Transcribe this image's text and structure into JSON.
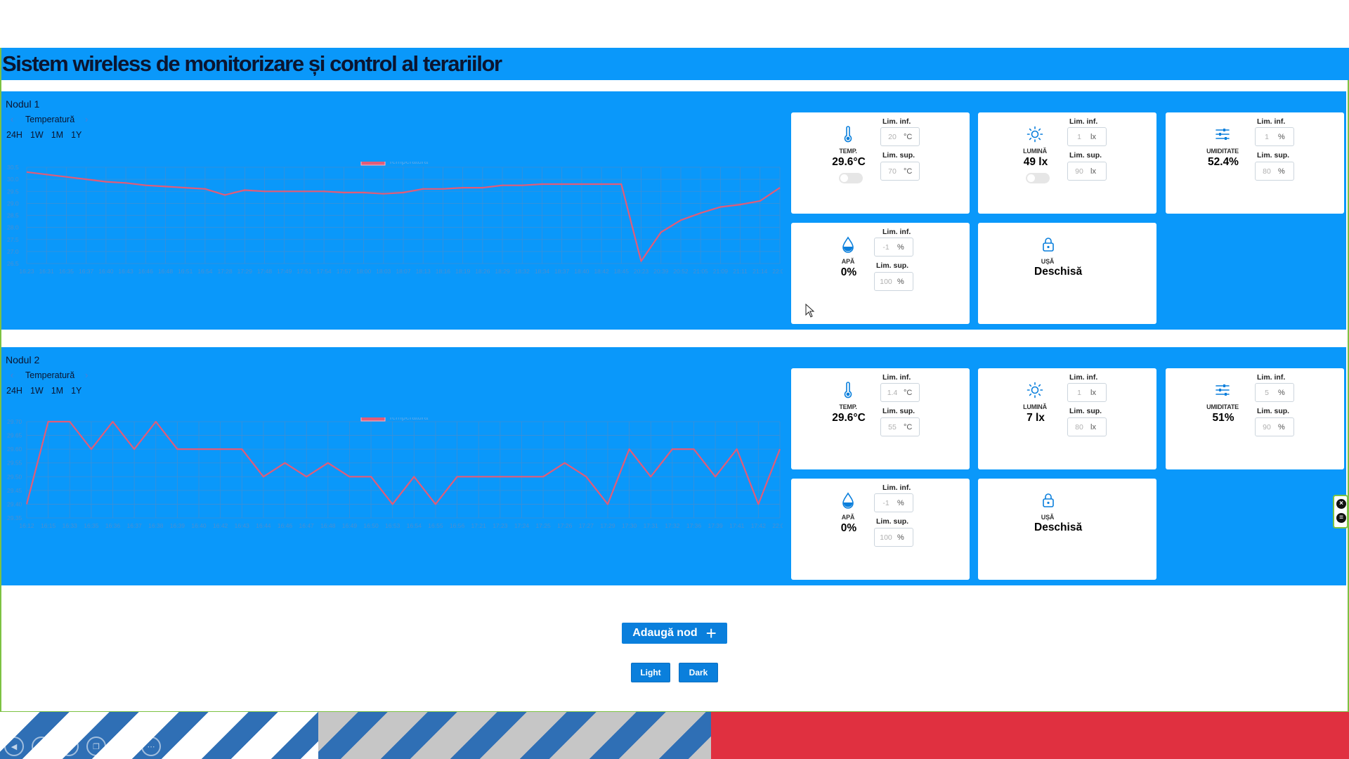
{
  "app": {
    "title": "Sistem wireless de monitorizare și control al terariilor",
    "colors": {
      "accent": "#0a98fa",
      "button": "#0a7fdc",
      "line": "#e25c78",
      "frame": "#7dc242"
    }
  },
  "nodes": [
    {
      "name": "Nodul 1",
      "sensor_label": "Temperatură",
      "ranges": [
        "24H",
        "1W",
        "1M",
        "1Y"
      ],
      "cards": {
        "temp": {
          "label": "TEMP.",
          "value": "29.6°C",
          "lim_inf_label": "Lim. inf.",
          "lim_inf": "20",
          "lim_sup_label": "Lim. sup.",
          "lim_sup": "70",
          "unit": "°C",
          "icon": "thermometer-icon"
        },
        "light": {
          "label": "LUMINĂ",
          "value": "49 lx",
          "lim_inf_label": "Lim. inf.",
          "lim_inf": "1",
          "lim_sup_label": "Lim. sup.",
          "lim_sup": "90",
          "unit": "lx",
          "icon": "sun-icon"
        },
        "humidity": {
          "label": "UMIDITATE",
          "value": "52.4%",
          "lim_inf_label": "Lim. inf.",
          "lim_inf": "1",
          "lim_sup_label": "Lim. sup.",
          "lim_sup": "80",
          "unit": "%",
          "icon": "sliders-icon"
        },
        "water": {
          "label": "APĂ",
          "value": "0%",
          "lim_inf_label": "Lim. inf.",
          "lim_inf": "-1",
          "lim_sup_label": "Lim. sup.",
          "lim_sup": "100",
          "unit": "%",
          "icon": "water-drop-icon"
        },
        "door": {
          "label": "UȘĂ",
          "value": "Deschisă",
          "icon": "lock-icon"
        }
      }
    },
    {
      "name": "Nodul 2",
      "sensor_label": "Temperatură",
      "ranges": [
        "24H",
        "1W",
        "1M",
        "1Y"
      ],
      "cards": {
        "temp": {
          "label": "TEMP.",
          "value": "29.6°C",
          "lim_inf_label": "Lim. inf.",
          "lim_inf": "1.4",
          "lim_sup_label": "Lim. sup.",
          "lim_sup": "55",
          "unit": "°C",
          "icon": "thermometer-icon"
        },
        "light": {
          "label": "LUMINĂ",
          "value": "7 lx",
          "lim_inf_label": "Lim. inf.",
          "lim_inf": "1",
          "lim_sup_label": "Lim. sup.",
          "lim_sup": "80",
          "unit": "lx",
          "icon": "sun-icon"
        },
        "humidity": {
          "label": "UMIDITATE",
          "value": "51%",
          "lim_inf_label": "Lim. inf.",
          "lim_inf": "5",
          "lim_sup_label": "Lim. sup.",
          "lim_sup": "90",
          "unit": "%",
          "icon": "sliders-icon"
        },
        "water": {
          "label": "APĂ",
          "value": "0%",
          "lim_inf_label": "Lim. inf.",
          "lim_inf": "-1",
          "lim_sup_label": "Lim. sup.",
          "lim_sup": "100",
          "unit": "%",
          "icon": "water-drop-icon"
        },
        "door": {
          "label": "UȘĂ",
          "value": "Deschisă",
          "icon": "lock-icon"
        }
      }
    }
  ],
  "actions": {
    "add_node": "Adaugă nod",
    "light": "Light",
    "dark": "Dark"
  },
  "chart_data": [
    {
      "type": "line",
      "legend": "Temperatură",
      "legend_position": "top",
      "grid": true,
      "ylim": [
        26.5,
        30.5
      ],
      "yticks": [
        "30.5",
        "30.0",
        "29.5",
        "29.0",
        "28.5",
        "28.0",
        "27.5",
        "27.0",
        "26.5"
      ],
      "x": [
        "16:23",
        "16:31",
        "16:35",
        "16:37",
        "16:40",
        "16:43",
        "16:46",
        "16:48",
        "16:51",
        "16:54",
        "17:28",
        "17:29",
        "17:48",
        "17:49",
        "17:51",
        "17:54",
        "17:57",
        "18:00",
        "18:03",
        "18:07",
        "18:13",
        "18:16",
        "18:19",
        "18:26",
        "18:29",
        "18:32",
        "18:34",
        "18:37",
        "18:40",
        "18:42",
        "18:45",
        "20:23",
        "20:39",
        "20:52",
        "21:05",
        "21:09",
        "21:11",
        "21:14",
        "22:01"
      ],
      "series": [
        {
          "values": [
            30.3,
            30.2,
            30.1,
            30.0,
            29.9,
            29.85,
            29.75,
            29.7,
            29.65,
            29.6,
            29.35,
            29.55,
            29.5,
            29.5,
            29.5,
            29.5,
            29.45,
            29.45,
            29.4,
            29.45,
            29.6,
            29.6,
            29.65,
            29.65,
            29.75,
            29.75,
            29.8,
            29.8,
            29.8,
            29.8,
            29.8,
            26.6,
            27.8,
            28.3,
            28.6,
            28.85,
            28.95,
            29.1,
            29.65
          ]
        }
      ]
    },
    {
      "type": "line",
      "legend": "Temperatură",
      "legend_position": "top",
      "grid": true,
      "ylim": [
        29.35,
        29.7
      ],
      "yticks": [
        "29.70",
        "29.65",
        "29.60",
        "29.55",
        "29.50",
        "29.45",
        "29.40",
        "29.35"
      ],
      "x": [
        "16:12",
        "16:15",
        "16:33",
        "16:35",
        "16:36",
        "16:37",
        "16:38",
        "16:39",
        "16:40",
        "16:42",
        "16:43",
        "16:44",
        "16:46",
        "16:47",
        "16:48",
        "16:49",
        "16:50",
        "16:53",
        "16:54",
        "16:55",
        "16:56",
        "17:21",
        "17:23",
        "17:24",
        "17:25",
        "17:26",
        "17:27",
        "17:29",
        "17:30",
        "17:31",
        "17:32",
        "17:36",
        "17:39",
        "17:41",
        "17:42",
        "22:02"
      ],
      "series": [
        {
          "values": [
            29.4,
            29.7,
            29.7,
            29.6,
            29.7,
            29.6,
            29.7,
            29.6,
            29.6,
            29.6,
            29.6,
            29.5,
            29.55,
            29.5,
            29.55,
            29.5,
            29.5,
            29.4,
            29.5,
            29.4,
            29.5,
            29.5,
            29.5,
            29.5,
            29.5,
            29.55,
            29.5,
            29.4,
            29.6,
            29.5,
            29.6,
            29.6,
            29.5,
            29.6,
            29.4,
            29.6
          ]
        }
      ]
    }
  ]
}
